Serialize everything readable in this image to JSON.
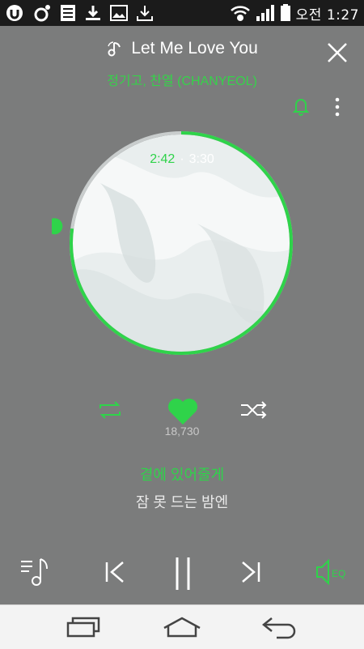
{
  "status_bar": {
    "time": "오전 1:27",
    "icons": [
      "uplus-icon",
      "melon-icon",
      "notes-icon",
      "download-icon",
      "image-icon",
      "download-icon",
      "wifi-icon",
      "signal-icon",
      "battery-icon"
    ]
  },
  "song": {
    "title": "Let Me Love You",
    "artist": "정기고, 찬열 (CHANYEOL)"
  },
  "progress": {
    "current": "2:42",
    "total": "3:30",
    "fraction": 0.771
  },
  "likes": {
    "count": "18,730"
  },
  "lyrics": {
    "current_line": "곁에 있어줄게",
    "next_line": "잠 못 드는 밤엔"
  },
  "colors": {
    "accent": "#2fd34a",
    "background": "#7b7c7c",
    "status_bar": "#1b1b1b",
    "nav_bar": "#f3f3f3"
  },
  "player_controls": [
    "playlist-icon",
    "previous-icon",
    "pause-icon",
    "next-icon",
    "equalizer-icon"
  ],
  "nav_bar": [
    "recent-apps-icon",
    "home-icon",
    "back-icon"
  ]
}
